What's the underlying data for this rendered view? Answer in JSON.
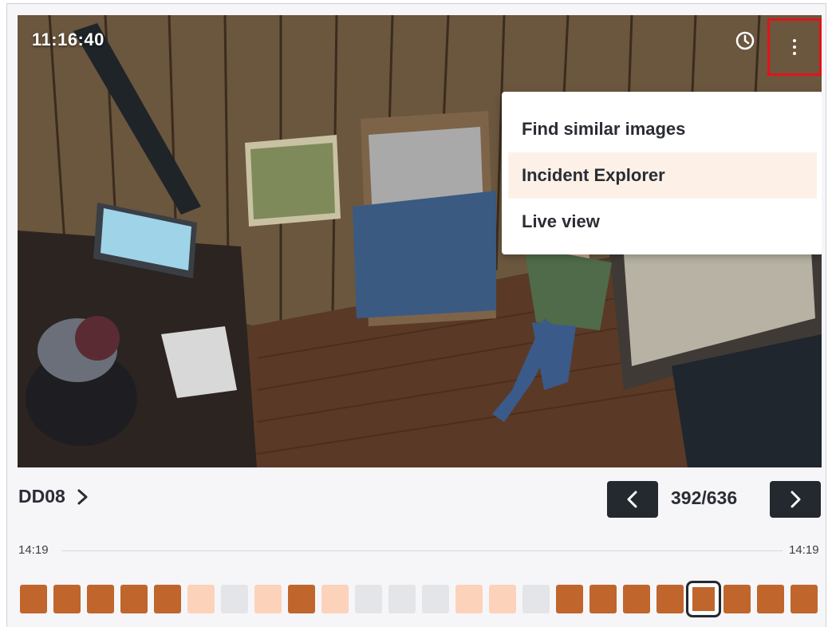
{
  "viewer": {
    "timestamp": "11:16:40",
    "clock_icon": "clock-icon",
    "more_icon": "more-vertical-icon"
  },
  "menu": {
    "items": [
      {
        "label": "Find similar images",
        "active": false
      },
      {
        "label": "Incident Explorer",
        "active": true
      },
      {
        "label": "Live view",
        "active": false
      }
    ]
  },
  "controls": {
    "camera_name": "DD08",
    "counter": "392/636",
    "prev_icon": "chevron-left-icon",
    "next_icon": "chevron-right-icon"
  },
  "timeline": {
    "start": "14:19",
    "end": "14:19",
    "colors": {
      "high": "#c0662c",
      "low": "#fdd2bb",
      "none": "#e4e5e8",
      "selected_border": "#24292f"
    },
    "segments": [
      "high",
      "high",
      "high",
      "high",
      "high",
      "low",
      "none",
      "low",
      "high",
      "low",
      "none",
      "none",
      "none",
      "low",
      "low",
      "none",
      "high",
      "high",
      "high",
      "high",
      "high",
      "high",
      "high",
      "high"
    ],
    "selected_index": 20
  }
}
